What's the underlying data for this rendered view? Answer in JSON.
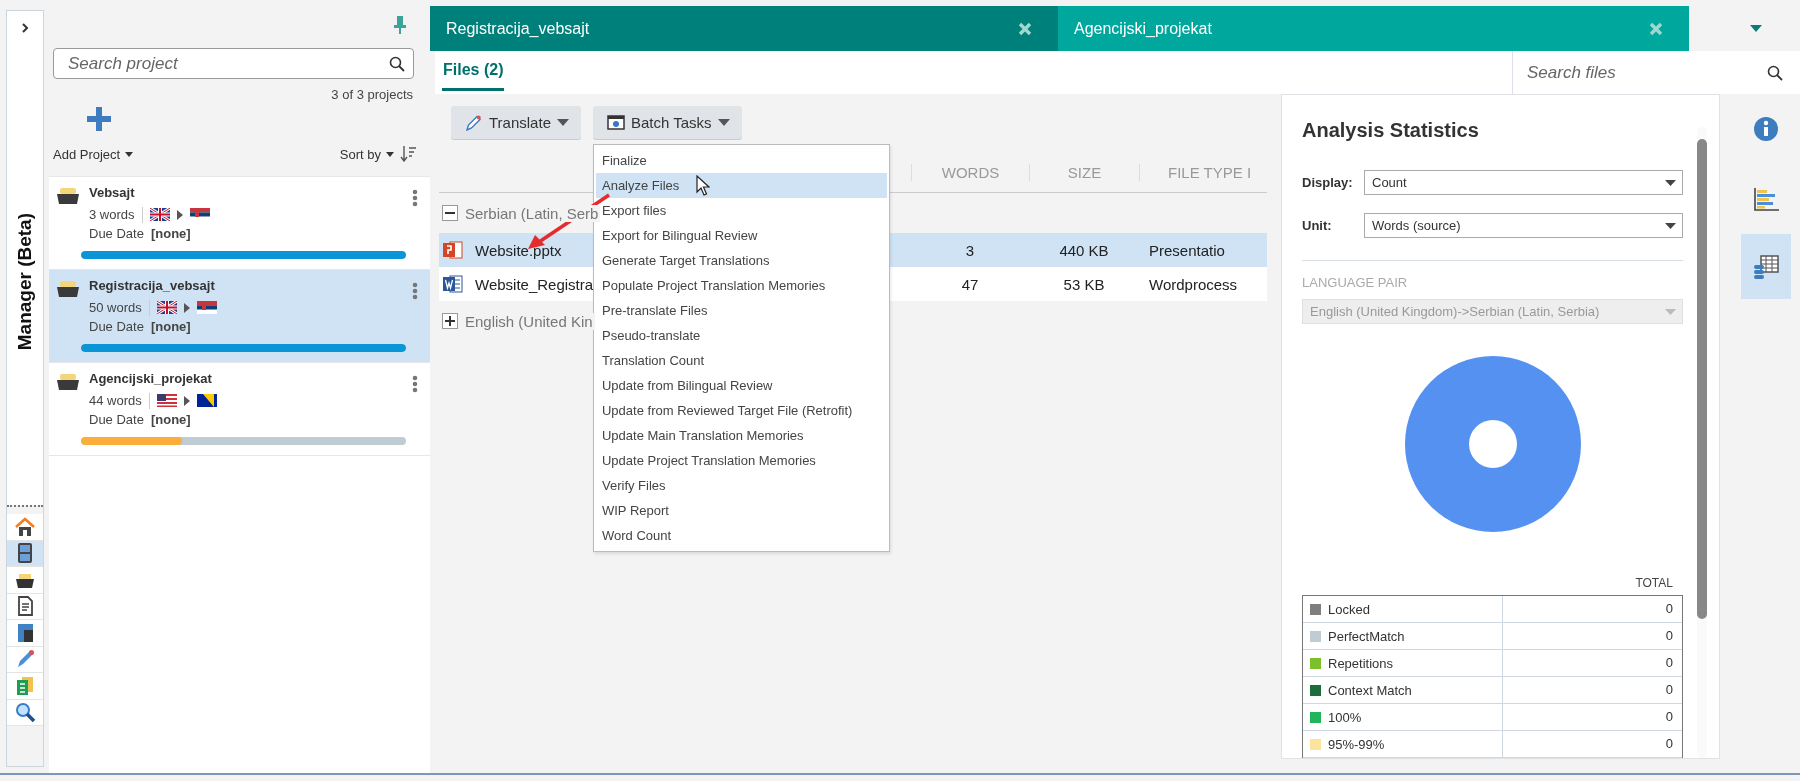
{
  "rail": {
    "title": "Manager (Beta)",
    "nav_buttons": [
      {
        "selected": false
      },
      {
        "selected": true
      },
      {
        "selected": false
      },
      {
        "selected": false
      },
      {
        "selected": false
      },
      {
        "selected": false
      },
      {
        "selected": false
      },
      {
        "selected": false
      }
    ]
  },
  "projects_panel": {
    "search_placeholder": "Search project",
    "count": "3 of 3 projects",
    "add_label": "Add Project",
    "sort_label": "Sort by"
  },
  "projects": [
    {
      "name": "Vebsajt",
      "words": "3 words",
      "languages": [
        {
          "kind": "gb"
        },
        {
          "kind": "rs"
        }
      ],
      "due_label": "Due Date",
      "due_value": "[none]",
      "level": 1,
      "color": "#0a96d6",
      "selected": false
    },
    {
      "name": "Registracija_vebsajt",
      "words": "50 words",
      "languages": [
        {
          "kind": "gb"
        },
        {
          "kind": "rs"
        }
      ],
      "due_label": "Due Date",
      "due_value": "[none]",
      "level": 1,
      "color": "#0a96d6",
      "selected": true
    },
    {
      "name": "Agencijski_projekat",
      "words": "44 words",
      "languages": [
        {
          "kind": "us"
        },
        {
          "kind": "ba"
        }
      ],
      "due_label": "Due Date",
      "due_value": "[none]",
      "level": 0.31,
      "color": "#fbae3c",
      "selected": false
    }
  ],
  "tabs": [
    {
      "label": "Registracija_vebsajt",
      "selected": true
    },
    {
      "label": "Agencijski_projekat",
      "selected": false
    }
  ],
  "view_tabs": [
    {
      "label": "Files (2)",
      "selected": true
    }
  ],
  "files_search": {
    "placeholder": "Search files"
  },
  "toolbar": [
    {
      "label": "Translate",
      "kind": "pencil"
    },
    {
      "label": "Batch Tasks",
      "kind": "batch"
    }
  ],
  "batch_menu": [
    {
      "label": "Finalize",
      "selected": false
    },
    {
      "label": "Analyze Files",
      "selected": true
    },
    {
      "label": "Export files",
      "selected": false
    },
    {
      "label": "Export for Bilingual Review",
      "selected": false
    },
    {
      "label": "Generate Target Translations",
      "selected": false
    },
    {
      "label": "Populate Project Translation Memories",
      "selected": false
    },
    {
      "label": "Pre-translate Files",
      "selected": false
    },
    {
      "label": "Pseudo-translate",
      "selected": false
    },
    {
      "label": "Translation Count",
      "selected": false
    },
    {
      "label": "Update from Bilingual Review",
      "selected": false
    },
    {
      "label": "Update from Reviewed Target File (Retrofit)",
      "selected": false
    },
    {
      "label": "Update Main Translation Memories",
      "selected": false
    },
    {
      "label": "Update Project Translation Memories",
      "selected": false
    },
    {
      "label": "Verify Files",
      "selected": false
    },
    {
      "label": "WIP Report",
      "selected": false
    },
    {
      "label": "Word Count",
      "selected": false
    }
  ],
  "files_table": {
    "columns": [
      "WORDS",
      "SIZE",
      "FILE TYPE I"
    ],
    "groups": [
      {
        "label": "Serbian (Latin, Serb",
        "expanded": true,
        "rows": [
          {
            "name": "Website.pptx",
            "kind": "powerpoint",
            "words": "3",
            "size": "440 KB",
            "type": "Presentatio",
            "selected": true
          },
          {
            "name": "Website_Registra",
            "kind": "word",
            "words": "47",
            "size": "53 KB",
            "type": "Wordprocess",
            "selected": false
          }
        ]
      },
      {
        "label": "English (United Kin",
        "expanded": false
      }
    ]
  },
  "stats": {
    "title": "Analysis Statistics",
    "display_label": "Display:",
    "display_value": "Count",
    "unit_label": "Unit:",
    "unit_value": "Words (source)",
    "pair_heading": "LANGUAGE PAIR",
    "pair_value": "English (United Kingdom)->Serbian (Latin, Serbia)",
    "total_heading": "TOTAL",
    "rows": [
      {
        "label": "Locked",
        "color": "#7f7f7f",
        "value": "0"
      },
      {
        "label": "PerfectMatch",
        "color": "#bfccd4",
        "value": "0"
      },
      {
        "label": "Repetitions",
        "color": "#7ac12a",
        "value": "0"
      },
      {
        "label": "Context Match",
        "color": "#1b6e3c",
        "value": "0"
      },
      {
        "label": "100%",
        "color": "#22b45a",
        "value": "0"
      },
      {
        "label": "95%-99%",
        "color": "#fde39c",
        "value": "0"
      }
    ]
  },
  "side_buttons": [
    {
      "selected": false
    },
    {
      "selected": false
    },
    {
      "selected": true
    }
  ]
}
